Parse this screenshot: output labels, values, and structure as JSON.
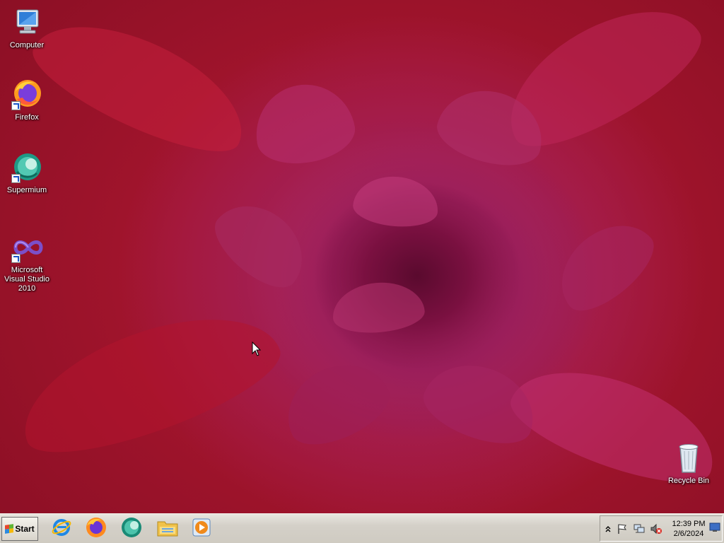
{
  "desktop": {
    "icons": [
      {
        "label": "Computer"
      },
      {
        "label": "Firefox"
      },
      {
        "label": "Supermium"
      },
      {
        "label": "Microsoft Visual Studio 2010"
      },
      {
        "label": "Recycle Bin"
      }
    ]
  },
  "taskbar": {
    "start_label": "Start",
    "pinned": [
      {
        "icon": "internet-explorer-icon"
      },
      {
        "icon": "firefox-icon"
      },
      {
        "icon": "supermium-icon"
      },
      {
        "icon": "file-explorer-icon"
      },
      {
        "icon": "media-player-icon"
      }
    ]
  },
  "tray": {
    "icons": [
      "show-hidden-icons-chevron",
      "action-center-flag-icon",
      "network-icon",
      "volume-muted-icon"
    ],
    "time": "12:39 PM",
    "date": "2/6/2024"
  }
}
